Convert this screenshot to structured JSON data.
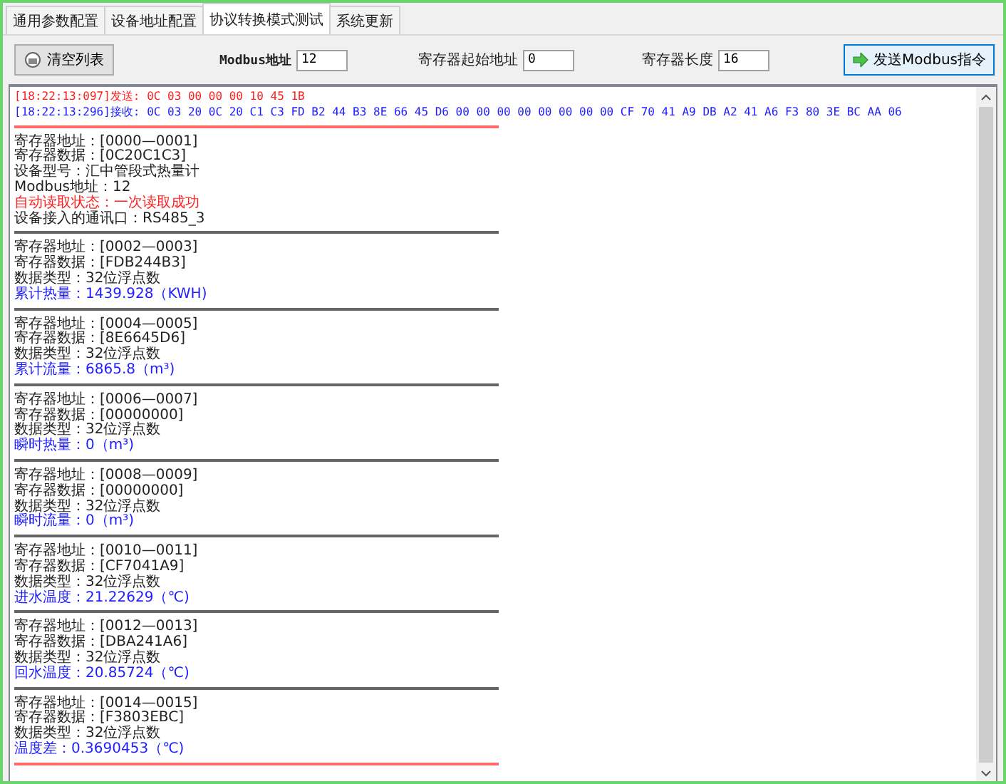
{
  "tabs": [
    {
      "label": "通用参数配置",
      "selected": false
    },
    {
      "label": "设备地址配置",
      "selected": false
    },
    {
      "label": "协议转换模式测试",
      "selected": true
    },
    {
      "label": "系统更新",
      "selected": false
    }
  ],
  "toolbar": {
    "clear_button": "清空列表",
    "modbus_address": {
      "label": "Modbus地址",
      "value": "12"
    },
    "start_address": {
      "label": "寄存器起始地址",
      "value": "0"
    },
    "register_length": {
      "label": "寄存器长度",
      "value": "16"
    },
    "send_button": "发送Modbus指令"
  },
  "log": {
    "messages": [
      {
        "kind": "send",
        "text": "[18:22:13:097]发送:  0C 03 00 00 00 10 45 1B"
      },
      {
        "kind": "receive",
        "text": "[18:22:13:296]接收:  0C 03 20 0C 20 C1 C3 FD B2 44 B3 8E 66 45 D6 00 00 00 00 00 00 00 00 CF 70 41 A9 DB A2 41 A6 F3 80 3E BC AA 06"
      }
    ],
    "sections": [
      {
        "lines": [
          {
            "kind": "plain",
            "text": "寄存器地址：[0000—0001]"
          },
          {
            "kind": "plain",
            "text": "寄存器数据：[0C20C1C3]"
          },
          {
            "kind": "plain",
            "text": "设备型号：汇中管段式热量计"
          },
          {
            "kind": "plain",
            "text": "Modbus地址：12"
          },
          {
            "kind": "alert",
            "text": "自动读取状态：一次读取成功"
          },
          {
            "kind": "plain",
            "text": "设备接入的通讯口：RS485_3"
          }
        ]
      },
      {
        "lines": [
          {
            "kind": "plain",
            "text": "寄存器地址：[0002—0003]"
          },
          {
            "kind": "plain",
            "text": "寄存器数据：[FDB244B3]"
          },
          {
            "kind": "plain",
            "text": "数据类型：32位浮点数"
          },
          {
            "kind": "value",
            "text": "累计热量：1439.928（KWH)"
          }
        ]
      },
      {
        "lines": [
          {
            "kind": "plain",
            "text": "寄存器地址：[0004—0005]"
          },
          {
            "kind": "plain",
            "text": "寄存器数据：[8E6645D6]"
          },
          {
            "kind": "plain",
            "text": "数据类型：32位浮点数"
          },
          {
            "kind": "value",
            "text": "累计流量：6865.8（m³)"
          }
        ]
      },
      {
        "lines": [
          {
            "kind": "plain",
            "text": "寄存器地址：[0006—0007]"
          },
          {
            "kind": "plain",
            "text": "寄存器数据：[00000000]"
          },
          {
            "kind": "plain",
            "text": "数据类型：32位浮点数"
          },
          {
            "kind": "value",
            "text": "瞬时热量：0（m³)"
          }
        ]
      },
      {
        "lines": [
          {
            "kind": "plain",
            "text": "寄存器地址：[0008—0009]"
          },
          {
            "kind": "plain",
            "text": "寄存器数据：[00000000]"
          },
          {
            "kind": "plain",
            "text": "数据类型：32位浮点数"
          },
          {
            "kind": "value",
            "text": "瞬时流量：0（m³)"
          }
        ]
      },
      {
        "lines": [
          {
            "kind": "plain",
            "text": "寄存器地址：[0010—0011]"
          },
          {
            "kind": "plain",
            "text": "寄存器数据：[CF7041A9]"
          },
          {
            "kind": "plain",
            "text": "数据类型：32位浮点数"
          },
          {
            "kind": "value",
            "text": "进水温度：21.22629（℃)"
          }
        ]
      },
      {
        "lines": [
          {
            "kind": "plain",
            "text": "寄存器地址：[0012—0013]"
          },
          {
            "kind": "plain",
            "text": "寄存器数据：[DBA241A6]"
          },
          {
            "kind": "plain",
            "text": "数据类型：32位浮点数"
          },
          {
            "kind": "value",
            "text": "回水温度：20.85724（℃)"
          }
        ]
      },
      {
        "lines": [
          {
            "kind": "plain",
            "text": "寄存器地址：[0014—0015]"
          },
          {
            "kind": "plain",
            "text": "寄存器数据：[F3803EBC]"
          },
          {
            "kind": "plain",
            "text": "数据类型：32位浮点数"
          },
          {
            "kind": "value",
            "text": "温度差：0.3690453（℃)"
          }
        ]
      }
    ]
  }
}
